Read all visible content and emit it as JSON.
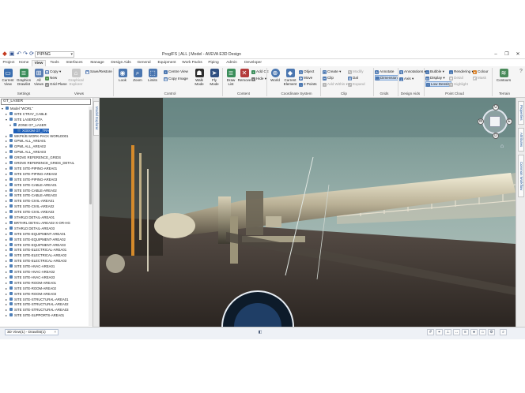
{
  "titlebar": {
    "app_icon": "ProgIFS",
    "quick_access": [
      "save-icon",
      "undo-icon",
      "redo-icon",
      "refresh-icon"
    ],
    "combo_value": "PIPING",
    "title": "ProgIFS | ALL | Model - AVEVA E3D Design",
    "controls": [
      "minimize-icon",
      "restore-icon",
      "close-icon"
    ]
  },
  "tabs": [
    "Project",
    "Home",
    "View",
    "Tools",
    "Interfaces",
    "Manage",
    "Design Aids",
    "General",
    "Equipment",
    "Work Packs",
    "Piping",
    "Admin",
    "Developer"
  ],
  "active_tab": "View",
  "ribbon": {
    "settings": {
      "label": "Settings",
      "current_view": "Current View",
      "graphics_drawlist": "Graphics Drawlist",
      "copy": "Copy",
      "new": "New",
      "all_views": "All Views",
      "grid_plane": "Grid Plane",
      "graphical_explorer": "Graphical Explorer",
      "save_restore": "Save/Restore"
    },
    "views": {
      "label": "Views"
    },
    "control": {
      "label": "Control",
      "look": "Look",
      "zoom": "Zoom",
      "limits": "Limits",
      "centre_view": "Centre View",
      "copy_image": "Copy Image",
      "walk_mode": "Walk Mode",
      "fly_mode": "Fly Mode"
    },
    "content": {
      "label": "Content",
      "draw_list": "Draw List",
      "remove": "Remove",
      "add_ce": "Add CE",
      "hide": "Hide"
    },
    "coordinate_system": {
      "label": "Coordinate System",
      "world": "World",
      "current_element": "Current Element",
      "object": "Object",
      "move": "Move",
      "two_points": "2 Points"
    },
    "clip": {
      "label": "Clip",
      "create": "Create",
      "clip": "Clip",
      "add_within": "Add Within",
      "modify": "Modify",
      "dal": "Dal",
      "expand": "Expand"
    },
    "grids": {
      "label": "Grids",
      "annotate": "Annotate",
      "dimension": "Dimension"
    },
    "design_aids": {
      "label": "Design Aids",
      "annotations": "Annotations",
      "axis": "Axis"
    },
    "point_cloud": {
      "label": "Point Cloud",
      "bubble": "Bubble",
      "display": "Display",
      "low_density": "Low Density",
      "rendering": "Rendering",
      "detail": "Detail",
      "colour": "Colour",
      "mask": "Mask",
      "highlight": "Highlight"
    },
    "terrain": {
      "label": "Terrain",
      "contours": "Contours"
    }
  },
  "left_panel": {
    "search_value": "GT_LASER",
    "model_explorer_tab": "Model Explorer",
    "rows": [
      {
        "text": "Model \"WORL\"",
        "indent": 0,
        "tw": "▾",
        "sel": false
      },
      {
        "text": "SITE CTRAY_CABLE",
        "indent": 1,
        "tw": "▸",
        "sel": false
      },
      {
        "text": "SITE LASERDATA",
        "indent": 1,
        "tw": "▾",
        "sel": false
      },
      {
        "text": "ZONE GT_LASER",
        "indent": 2,
        "tw": "▾",
        "sel": false
      },
      {
        "text": "XGEOM GT_TRA",
        "indent": 3,
        "tw": "",
        "sel": true
      },
      {
        "text": "WKPK/B WORK-PACK WORLD001",
        "indent": 1,
        "tw": "▸",
        "sel": false
      },
      {
        "text": "GPWL ALL_AREA01",
        "indent": 1,
        "tw": "▸",
        "sel": false
      },
      {
        "text": "GPWL ALL_AREA02",
        "indent": 1,
        "tw": "▸",
        "sel": false
      },
      {
        "text": "GPWL ALL_AREA03",
        "indent": 1,
        "tw": "▸",
        "sel": false
      },
      {
        "text": "GRDVE REFERENCE_GRIDS",
        "indent": 1,
        "tw": "▸",
        "sel": false
      },
      {
        "text": "GRDVE REFERENCE_GRIDS_DETAIL",
        "indent": 1,
        "tw": "▸",
        "sel": false
      },
      {
        "text": "SITE SITE-PIPING-AREA01",
        "indent": 1,
        "tw": "▸",
        "sel": false
      },
      {
        "text": "SITE SITE-PIPING-AREA02",
        "indent": 1,
        "tw": "▸",
        "sel": false
      },
      {
        "text": "SITE SITE-PIPING-AREA03",
        "indent": 1,
        "tw": "▸",
        "sel": false
      },
      {
        "text": "SITE SITE-CABLE-AREA01",
        "indent": 1,
        "tw": "▸",
        "sel": false
      },
      {
        "text": "SITE SITE-CABLE-AREA02",
        "indent": 1,
        "tw": "▸",
        "sel": false
      },
      {
        "text": "SITE SITE-CABLE-AREA03",
        "indent": 1,
        "tw": "▸",
        "sel": false
      },
      {
        "text": "SITE SITE-CIVIL-AREA01",
        "indent": 1,
        "tw": "▸",
        "sel": false
      },
      {
        "text": "SITE SITE-CIVIL-AREA02",
        "indent": 1,
        "tw": "▸",
        "sel": false
      },
      {
        "text": "SITE SITE-CIVIL-AREA03",
        "indent": 1,
        "tw": "▸",
        "sel": false
      },
      {
        "text": "STHRLD DETAIL-AREA01",
        "indent": 1,
        "tw": "▸",
        "sel": false
      },
      {
        "text": "BRTHRL DETAIL-AREA02-X-OR-HG",
        "indent": 1,
        "tw": "▸",
        "sel": false
      },
      {
        "text": "STHRLD DETAIL-AREA03",
        "indent": 1,
        "tw": "▸",
        "sel": false
      },
      {
        "text": "SITE SITE-EQUIPMENT-AREA01",
        "indent": 1,
        "tw": "▸",
        "sel": false
      },
      {
        "text": "SITE SITE-EQUIPMENT-AREA02",
        "indent": 1,
        "tw": "▸",
        "sel": false
      },
      {
        "text": "SITE SITE-EQUIPMENT-AREA03",
        "indent": 1,
        "tw": "▸",
        "sel": false
      },
      {
        "text": "SITE SITE-ELECTRICAL-AREA01",
        "indent": 1,
        "tw": "▸",
        "sel": false
      },
      {
        "text": "SITE SITE-ELECTRICAL-AREA02",
        "indent": 1,
        "tw": "▸",
        "sel": false
      },
      {
        "text": "SITE SITE-ELECTRICAL-AREA03",
        "indent": 1,
        "tw": "▸",
        "sel": false
      },
      {
        "text": "SITE SITE-HVAC-AREA01",
        "indent": 1,
        "tw": "▸",
        "sel": false
      },
      {
        "text": "SITE SITE-HVAC-AREA02",
        "indent": 1,
        "tw": "▸",
        "sel": false
      },
      {
        "text": "SITE SITE-HVAC-AREA03",
        "indent": 1,
        "tw": "▸",
        "sel": false
      },
      {
        "text": "SITE SITE-ROOM-AREA01",
        "indent": 1,
        "tw": "▸",
        "sel": false
      },
      {
        "text": "SITE SITE-ROOM-AREA02",
        "indent": 1,
        "tw": "▸",
        "sel": false
      },
      {
        "text": "SITE SITE-ROOM-AREA03",
        "indent": 1,
        "tw": "▸",
        "sel": false
      },
      {
        "text": "SITE SITE-STRUCTURAL-AREA01",
        "indent": 1,
        "tw": "▸",
        "sel": false
      },
      {
        "text": "SITE SITE-STRUCTURAL-AREA02",
        "indent": 1,
        "tw": "▸",
        "sel": false
      },
      {
        "text": "SITE SITE-STRUCTURAL-AREA03",
        "indent": 1,
        "tw": "▸",
        "sel": false
      },
      {
        "text": "SITE SITE-SUPPORTS-AREA01",
        "indent": 1,
        "tw": "▸",
        "sel": false
      }
    ]
  },
  "right_tabs": [
    "Properties",
    "Attributes",
    "Common Workflow"
  ],
  "nav_cube": {
    "top": "U",
    "bottom": "D",
    "left": "W",
    "right": "E"
  },
  "statusbar": {
    "doc_tab": "3D View(1) - Drawlist(1)",
    "icons": [
      "grid-icon",
      "snap-icon",
      "ortho-icon",
      "measure-icon",
      "layers-icon",
      "palette-icon",
      "home-icon",
      "settings-icon"
    ]
  },
  "colors": {
    "accent": "#2b5c9e",
    "selection": "#1f5fb8",
    "sky": "#8aa8a6",
    "ground": "#3a3430"
  }
}
